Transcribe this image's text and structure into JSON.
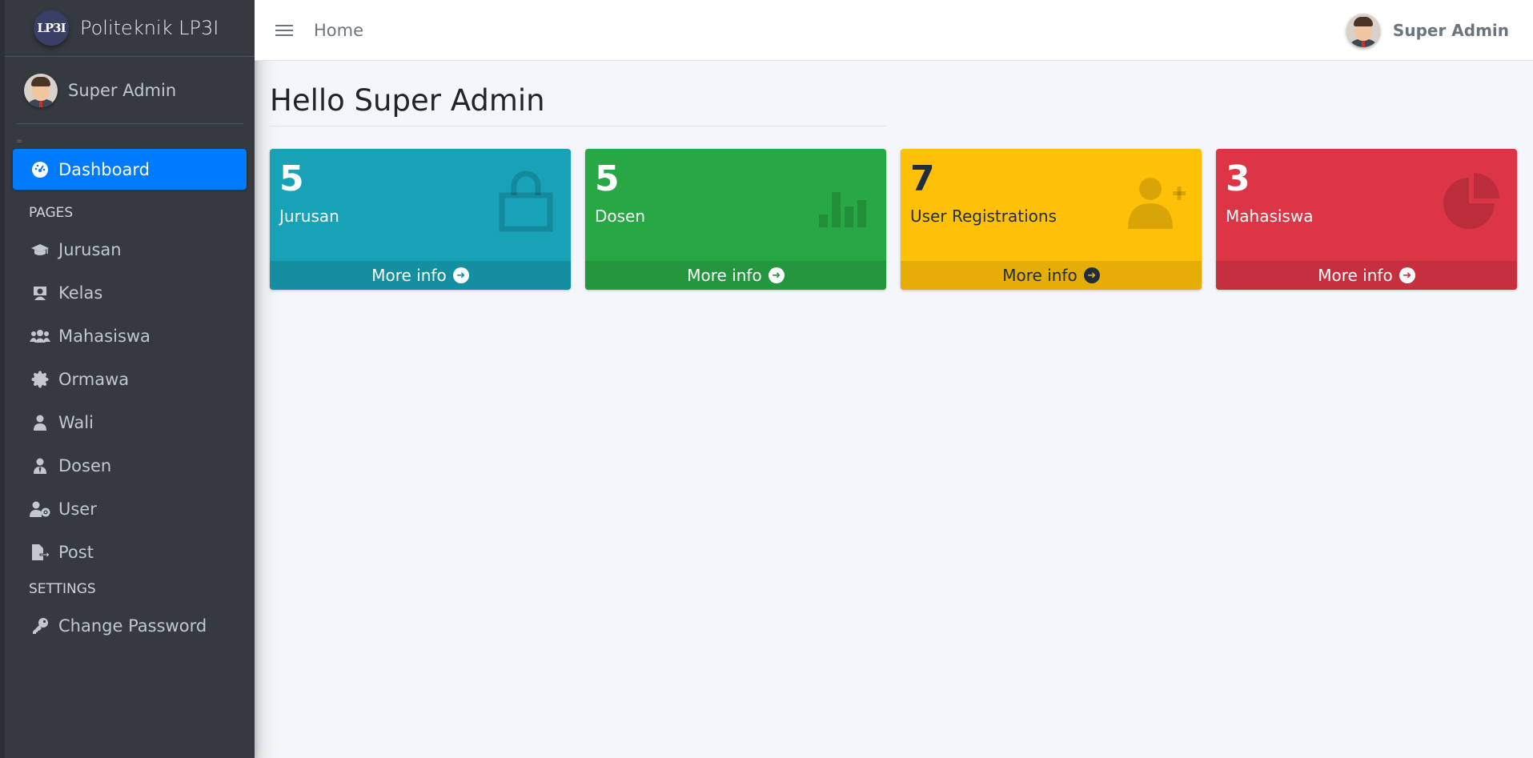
{
  "brand": {
    "logo_text": "LP3I",
    "name": "Politeknik LP3I"
  },
  "sidebar": {
    "user_name": "Super Admin",
    "dashboard_label": "Dashboard",
    "pages_header": "PAGES",
    "items": [
      {
        "label": "Jurusan",
        "icon": "graduation-cap-icon"
      },
      {
        "label": "Kelas",
        "icon": "chalkboard-teacher-icon"
      },
      {
        "label": "Mahasiswa",
        "icon": "users-icon"
      },
      {
        "label": "Ormawa",
        "icon": "certificate-icon"
      },
      {
        "label": "Wali",
        "icon": "user-icon"
      },
      {
        "label": "Dosen",
        "icon": "user-tie-icon"
      },
      {
        "label": "User",
        "icon": "user-cog-icon"
      },
      {
        "label": "Post",
        "icon": "file-export-icon"
      }
    ],
    "settings_header": "SETTINGS",
    "change_password_label": "Change Password"
  },
  "topbar": {
    "home_label": "Home",
    "user_name": "Super Admin"
  },
  "main": {
    "title": "Hello Super Admin",
    "boxes": [
      {
        "value": "5",
        "label": "Jurusan",
        "footer": "More info",
        "icon": "shopping-bag-icon",
        "color": "#17a2b8"
      },
      {
        "value": "5",
        "label": "Dosen",
        "footer": "More info",
        "icon": "bar-chart-icon",
        "color": "#28a745"
      },
      {
        "value": "7",
        "label": "User Registrations",
        "footer": "More info",
        "icon": "user-plus-icon",
        "color": "#ffc107"
      },
      {
        "value": "3",
        "label": "Mahasiswa",
        "footer": "More info",
        "icon": "pie-chart-icon",
        "color": "#dc3545"
      }
    ]
  },
  "colors": {
    "sidebar_bg": "#343a40",
    "active": "#007bff",
    "content_bg": "#f4f6f9"
  }
}
